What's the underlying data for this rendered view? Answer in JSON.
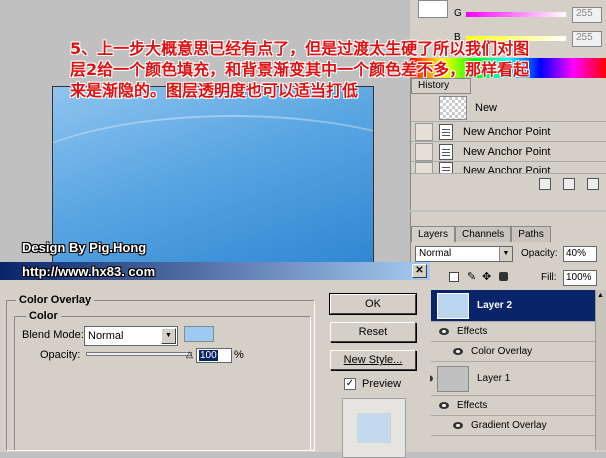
{
  "annotation": {
    "text": "5、上一步大概意思已经有点了，但是过渡太生硬了所以我们对图层2给一个颜色填充，和背景渐变其中一个颜色差不多，那样看起来是渐隐的。图层透明度也可以适当打低"
  },
  "credits": {
    "design_by": "Design By Pig.Hong",
    "url": "http://www.hx83. com"
  },
  "color_panel": {
    "channels": [
      {
        "label": "G",
        "value": "255"
      },
      {
        "label": "B",
        "value": "255"
      }
    ]
  },
  "history": {
    "tab": "History",
    "snapshot_label": "New",
    "items": [
      "New Anchor Point",
      "New Anchor Point",
      "New Anchor Point"
    ]
  },
  "layers": {
    "tabs": [
      "Layers",
      "Channels",
      "Paths"
    ],
    "blend_mode": "Normal",
    "opacity_label": "Opacity:",
    "opacity_value": "40%",
    "lock_label": "k:",
    "fill_label": "Fill:",
    "fill_value": "100%",
    "rows": [
      {
        "name": "Layer 2",
        "selected": true
      },
      {
        "effects_label": "Effects"
      },
      {
        "effect": "Color Overlay"
      },
      {
        "name": "Layer 1",
        "selected": false
      },
      {
        "effects_label": "Effects"
      },
      {
        "effect": "Gradient Overlay"
      }
    ]
  },
  "dialog": {
    "section_title": "Color Overlay",
    "group_title": "Color",
    "blend_mode_label": "Blend Mode:",
    "blend_mode_value": "Normal",
    "overlay_color": "#9ccaf2",
    "opacity_label": "Opacity:",
    "opacity_value": "100",
    "opacity_unit": "%",
    "opacity_level": 1.0,
    "buttons": {
      "ok": "OK",
      "reset": "Reset",
      "new_style": "New Style..."
    },
    "preview_label": "Preview",
    "preview_checked": true,
    "preview_color": "#c3d9ee"
  },
  "colors": {
    "selection_blue": "#0a246a",
    "annotation_red": "#e01010"
  }
}
